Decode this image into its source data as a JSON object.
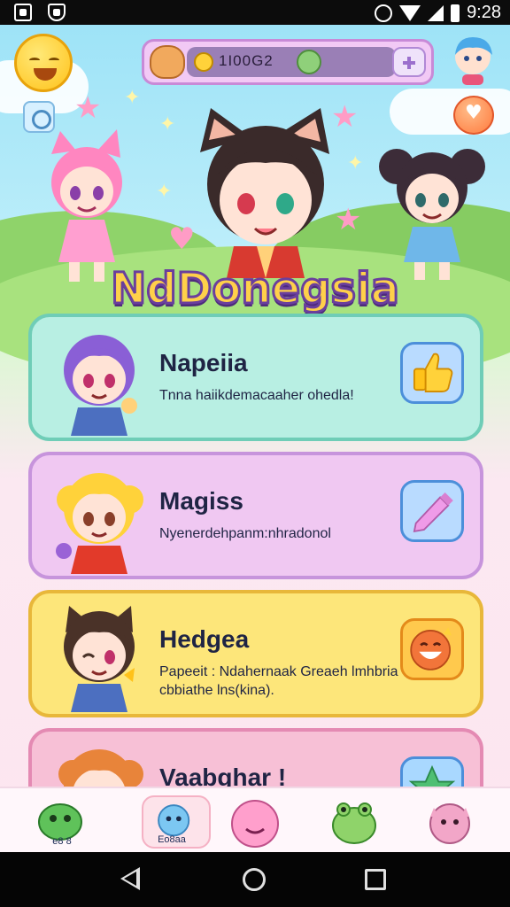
{
  "status_bar": {
    "time": "9:28"
  },
  "header": {
    "currency_value": "1I00G2",
    "game_title": "NdDonegsia"
  },
  "cards": [
    {
      "name": "Napeiia",
      "description": "Tnna haiikdemacaaher ohedla!",
      "action_icon": "thumbs-up-icon"
    },
    {
      "name": "Magiss",
      "description": "Nyenerdehpanm:nhradonol",
      "action_icon": "pencil-icon"
    },
    {
      "name": "Hedgea",
      "description": "Papeeit : Ndahernaak Greaeh lmhbria cbbiathe lns(kina).",
      "action_icon": "happy-face-icon"
    },
    {
      "name": "Vaabghar !",
      "description": "",
      "action_icon": "star-icon"
    }
  ],
  "tabs": [
    {
      "label": "e8 8",
      "icon": "green-slime-icon"
    },
    {
      "label": "Eo8aa",
      "icon": "blue-blob-icon"
    },
    {
      "label": "",
      "icon": "pink-cat-icon"
    },
    {
      "label": "",
      "icon": "frog-icon"
    },
    {
      "label": "",
      "icon": "pink-bear-icon"
    }
  ],
  "colors": {
    "card_1": "#b8efe3",
    "card_2": "#f0c8f2",
    "card_3": "#fde67a",
    "card_4": "#f7c0d6",
    "title_fill": "#ffd04a",
    "title_outline": "#6a3f9d"
  }
}
